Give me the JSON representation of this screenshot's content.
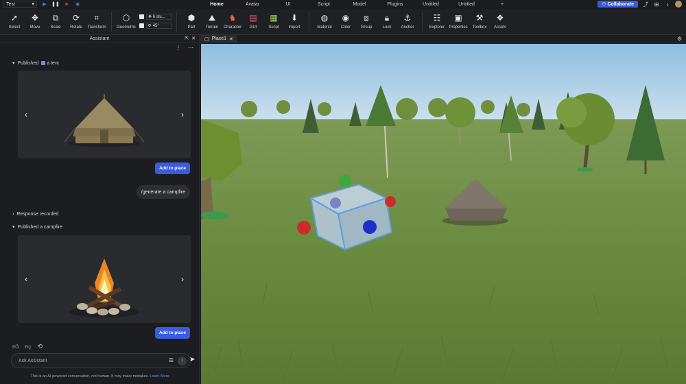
{
  "menubar": {
    "place_name": "Test",
    "tabs": [
      {
        "label": "Home",
        "active": true
      },
      {
        "label": "Avatar",
        "active": false
      },
      {
        "label": "UI",
        "active": false
      },
      {
        "label": "Script",
        "active": false
      },
      {
        "label": "Model",
        "active": false
      },
      {
        "label": "Plugins",
        "active": false
      },
      {
        "label": "Untitled",
        "active": false
      },
      {
        "label": "Untitled",
        "active": false
      },
      {
        "label": "+",
        "active": false
      }
    ],
    "collaborate_label": "Collaborate"
  },
  "toolbar": {
    "tools": [
      {
        "label": "Select",
        "icon": "cursor-icon"
      },
      {
        "label": "Move",
        "icon": "move-icon"
      },
      {
        "label": "Scale",
        "icon": "scale-icon"
      },
      {
        "label": "Rotate",
        "icon": "rotate-icon"
      },
      {
        "label": "Transform",
        "icon": "transform-icon"
      }
    ],
    "geometric_label": "Geometric",
    "snap_move": "6 stu...",
    "snap_rotate": "45°",
    "insert_tools": [
      {
        "label": "Part",
        "icon": "part-icon"
      },
      {
        "label": "Terrain",
        "icon": "terrain-icon"
      },
      {
        "label": "Character",
        "icon": "character-icon"
      },
      {
        "label": "GUI",
        "icon": "gui-icon"
      },
      {
        "label": "Script",
        "icon": "script-icon"
      },
      {
        "label": "Import",
        "icon": "import-icon"
      }
    ],
    "edit_tools": [
      {
        "label": "Material",
        "icon": "material-icon"
      },
      {
        "label": "Color",
        "icon": "color-icon"
      },
      {
        "label": "Group",
        "icon": "group-icon"
      },
      {
        "label": "Lock",
        "icon": "lock-icon"
      },
      {
        "label": "Anchor",
        "icon": "anchor-icon"
      }
    ],
    "window_tools": [
      {
        "label": "Explorer",
        "icon": "explorer-icon"
      },
      {
        "label": "Properties",
        "icon": "properties-icon"
      },
      {
        "label": "Toolbox",
        "icon": "toolbox-icon"
      },
      {
        "label": "Assets",
        "icon": "assets-icon"
      }
    ]
  },
  "assistant": {
    "title": "Assistant",
    "published_1_label": "Published",
    "published_1_asset": "a tent",
    "add_button_1": "Add to place",
    "user_message": "/generate a campfire",
    "response_recorded": "Response recorded",
    "published_2_label": "Published a campfire",
    "add_button_2": "Add to place",
    "input_placeholder": "Ask Assistant",
    "disclaimer": "This is an AI-powered conversation, not human. It may make mistakes.",
    "learn_more": "Learn More"
  },
  "viewport": {
    "tab_label": "Place1"
  },
  "colors": {
    "accent": "#3a5ce0",
    "panel_bg": "#1c1d20",
    "sky": "#9fc6e4",
    "grass": "#6f8f45"
  }
}
